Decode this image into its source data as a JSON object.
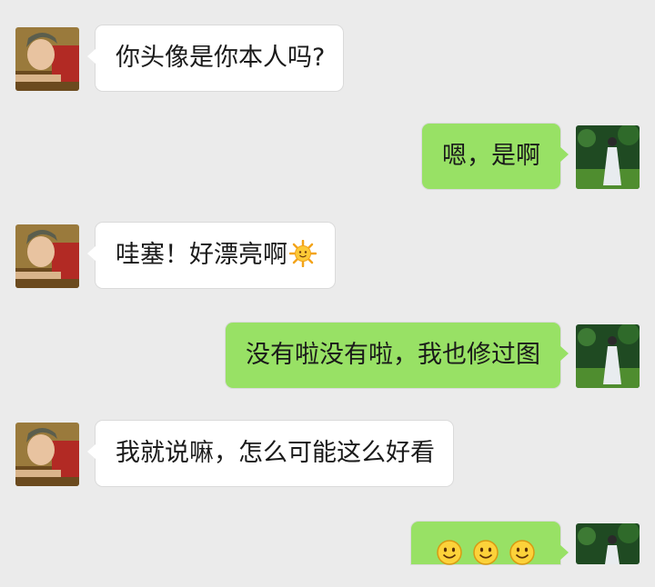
{
  "colors": {
    "background": "#ebebeb",
    "incoming_bubble": "#ffffff",
    "outgoing_bubble": "#98e165"
  },
  "messages": [
    {
      "side": "in",
      "text": "你头像是你本人吗?"
    },
    {
      "side": "out",
      "text": "嗯，是啊"
    },
    {
      "side": "in",
      "text": "哇塞！好漂亮啊",
      "emoji": "sun-emoji-icon"
    },
    {
      "side": "out",
      "text": "没有啦没有啦，我也修过图"
    },
    {
      "side": "in",
      "text": "我就说嘛，怎么可能这么好看"
    },
    {
      "side": "out",
      "text": "",
      "emoji": [
        "smile-emoji-icon",
        "smile-emoji-icon",
        "smile-emoji-icon"
      ]
    }
  ]
}
